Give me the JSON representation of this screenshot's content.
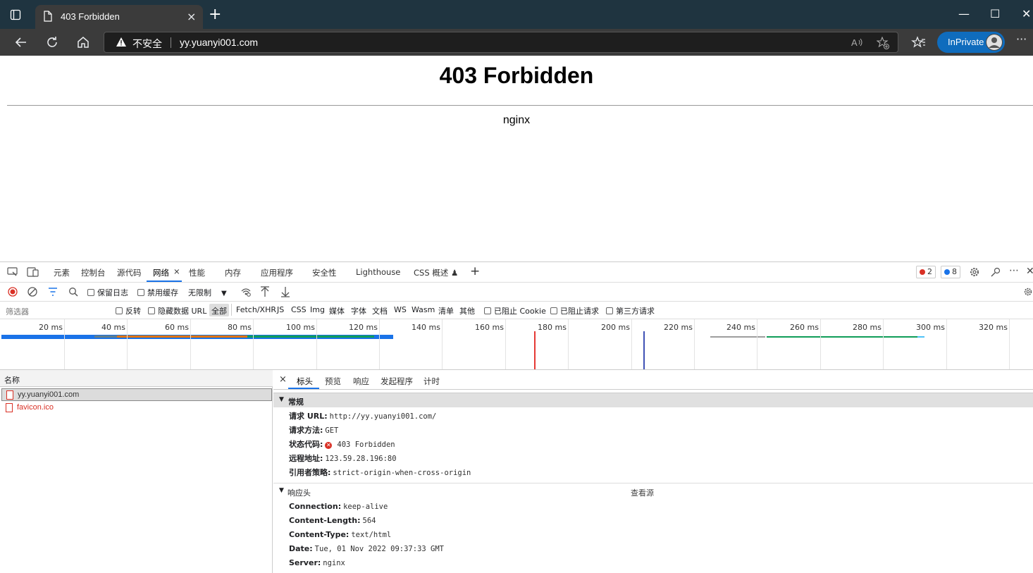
{
  "browser": {
    "tab_title": "403 Forbidden",
    "tab_close": "×",
    "new_tab": "+",
    "window": {
      "minimize": "—",
      "maximize": "☐",
      "close": "✕"
    },
    "address": {
      "security_label": "不安全",
      "url": "yy.yuanyi001.com"
    },
    "inprivate_label": "InPrivate",
    "more_menu": "···"
  },
  "page": {
    "heading": "403 Forbidden",
    "server": "nginx"
  },
  "devtools": {
    "tabs": [
      "元素",
      "控制台",
      "源代码",
      "网络",
      "性能",
      "内存",
      "应用程序",
      "安全性",
      "Lighthouse",
      "CSS 概述 ♟"
    ],
    "active_tab": "网络",
    "add_tab": "+",
    "error_count": "2",
    "message_count": "8",
    "toolbar": {
      "preserve_log": "保留日志",
      "disable_cache": "禁用缓存",
      "throttling": "无限制"
    },
    "filter": {
      "placeholder": "筛选器",
      "invert": "反转",
      "hide_data_urls": "隐藏数据 URL",
      "types": [
        "全部",
        "Fetch/XHR",
        "JS",
        "CSS",
        "Img",
        "媒体",
        "字体",
        "文档",
        "WS",
        "Wasm",
        "清单",
        "其他"
      ],
      "blocked_cookies": "已阻止 Cookie",
      "blocked_requests": "已阻止请求",
      "third_party": "第三方请求"
    },
    "overview_ticks": [
      "20 ms",
      "40 ms",
      "60 ms",
      "80 ms",
      "100 ms",
      "120 ms",
      "140 ms",
      "160 ms",
      "180 ms",
      "200 ms",
      "220 ms",
      "240 ms",
      "260 ms",
      "280 ms",
      "300 ms",
      "320 ms"
    ],
    "request_list": {
      "header": "名称",
      "rows": [
        "yy.yuanyi001.com",
        "favicon.ico"
      ]
    },
    "detail_tabs": [
      "标头",
      "预览",
      "响应",
      "发起程序",
      "计时"
    ],
    "general": {
      "title": "常规",
      "items": [
        {
          "key": "请求 URL:",
          "value": "http://yy.yuanyi001.com/"
        },
        {
          "key": "请求方法:",
          "value": "GET"
        },
        {
          "key": "状态代码:",
          "value": "403 Forbidden"
        },
        {
          "key": "远程地址:",
          "value": "123.59.28.196:80"
        },
        {
          "key": "引用者策略:",
          "value": "strict-origin-when-cross-origin"
        }
      ]
    },
    "response_headers": {
      "title": "响应头",
      "view_source": "查看源",
      "items": [
        {
          "key": "Connection:",
          "value": "keep-alive"
        },
        {
          "key": "Content-Length:",
          "value": "564"
        },
        {
          "key": "Content-Type:",
          "value": "text/html"
        },
        {
          "key": "Date:",
          "value": "Tue, 01 Nov 2022 09:37:33 GMT"
        },
        {
          "key": "Server:",
          "value": "nginx"
        }
      ]
    }
  }
}
